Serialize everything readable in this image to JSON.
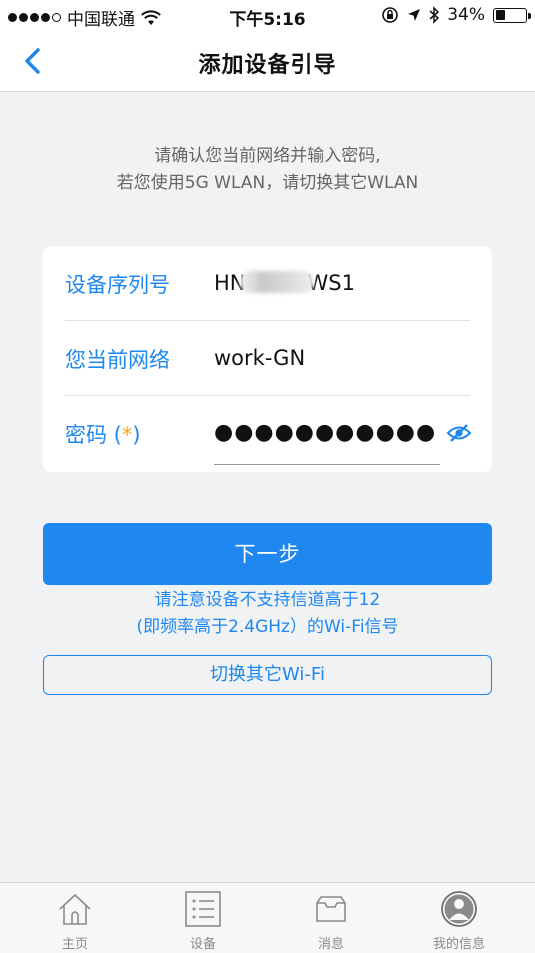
{
  "status_bar": {
    "carrier": "中国联通",
    "time": "下午5:16",
    "battery": "34%",
    "battery_level": 0.34
  },
  "nav": {
    "title": "添加设备引导"
  },
  "hint": {
    "line1": "请确认您当前网络并输入密码,",
    "line2": "若您使用5G WLAN，请切换其它WLAN"
  },
  "form": {
    "serial_label": "设备序列号",
    "serial_prefix": "HN",
    "serial_suffix": "WS1",
    "network_label": "您当前网络",
    "network_value": "work-GN",
    "password_label_text": "密码 (",
    "password_asterisk": "*",
    "password_label_close": ")",
    "password_masked": "●●●●●●●●●●●"
  },
  "actions": {
    "next_label": "下一步",
    "notice_line1": "请注意设备不支持信道高于12",
    "notice_line2": "(即频率高于2.4GHz）的Wi-Fi信号",
    "switch_wifi_label": "切换其它Wi-Fi"
  },
  "tab_bar": {
    "items": [
      {
        "label": "主页",
        "icon": "home-icon"
      },
      {
        "label": "设备",
        "icon": "device-list-icon"
      },
      {
        "label": "消息",
        "icon": "message-tray-icon"
      },
      {
        "label": "我的信息",
        "icon": "profile-icon"
      }
    ]
  },
  "colors": {
    "accent": "#1e87f0",
    "asterisk": "#f5a623",
    "background": "#f1f2f4"
  }
}
